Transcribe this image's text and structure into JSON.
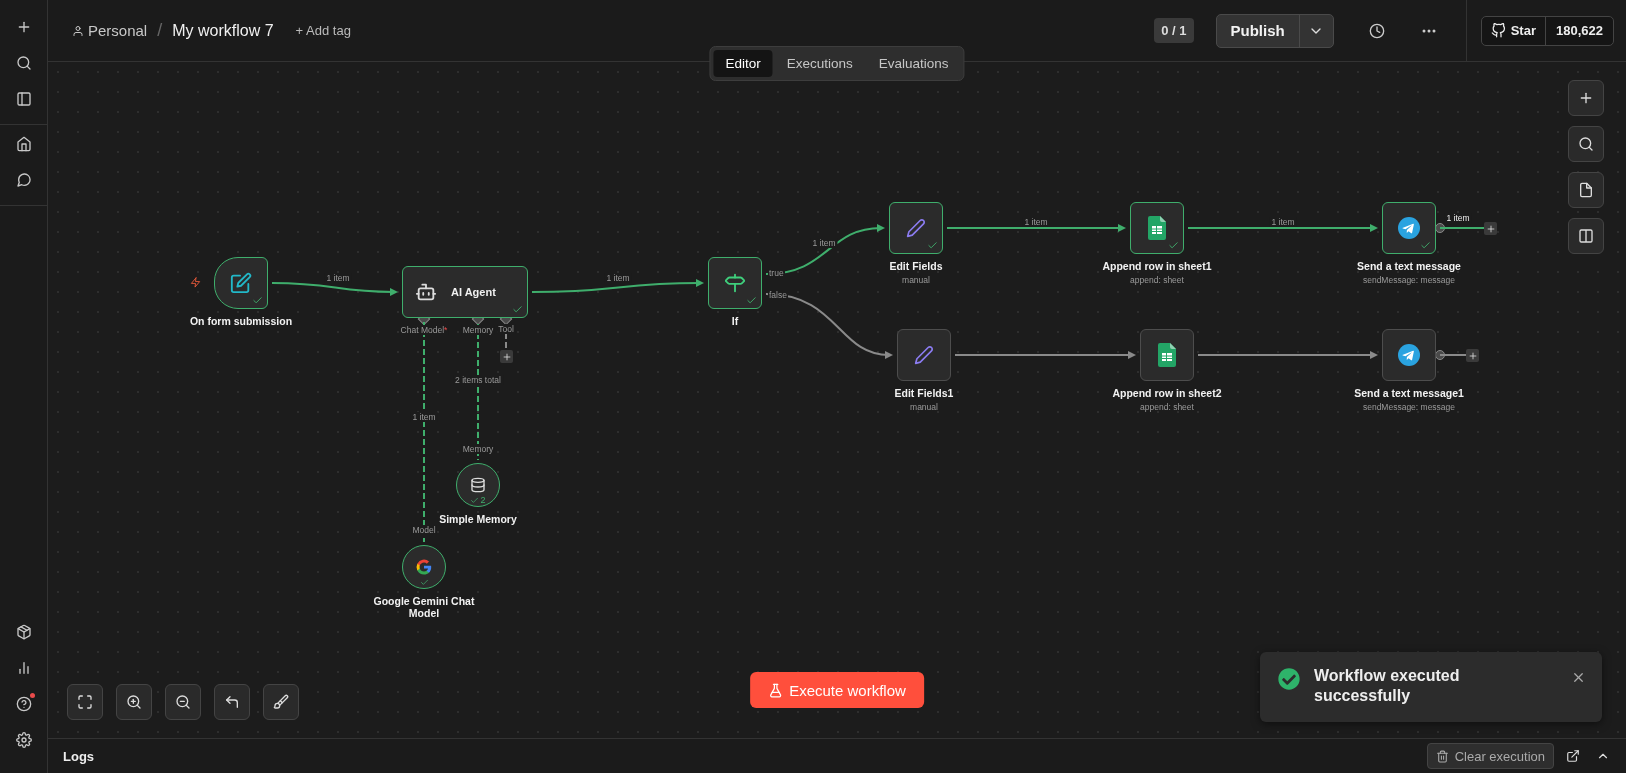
{
  "sidebar": {
    "help_notification": true
  },
  "top_bar": {
    "project": "Personal",
    "separator": "/",
    "workflow_name": "My workflow 7",
    "add_tag": "+ Add tag",
    "version_counter": "0 / 1",
    "publish": "Publish",
    "github": {
      "label": "Star",
      "count": "180,622"
    }
  },
  "tabs": [
    {
      "label": "Editor",
      "selected": true
    },
    {
      "label": "Executions",
      "selected": false
    },
    {
      "label": "Evaluations",
      "selected": false
    }
  ],
  "canvas": {
    "nodes": [
      {
        "name": "On form submission",
        "kind": "form_trigger",
        "executed": true
      },
      {
        "name": "AI Agent",
        "kind": "agent",
        "executed": true
      },
      {
        "name": "If",
        "kind": "if",
        "executed": true
      },
      {
        "name": "Edit Fields",
        "subtitle": "manual",
        "kind": "set",
        "executed": true
      },
      {
        "name": "Append row in sheet1",
        "subtitle": "append: sheet",
        "kind": "sheets",
        "executed": true
      },
      {
        "name": "Send a text message",
        "subtitle": "sendMessage: message",
        "kind": "telegram",
        "executed": true
      },
      {
        "name": "Edit Fields1",
        "subtitle": "manual",
        "kind": "set",
        "executed": false
      },
      {
        "name": "Append row in sheet2",
        "subtitle": "append: sheet",
        "kind": "sheets",
        "executed": false
      },
      {
        "name": "Send a text message1",
        "subtitle": "sendMessage: message",
        "kind": "telegram",
        "executed": false
      },
      {
        "name": "Simple Memory",
        "kind": "memory",
        "executed": true,
        "run_count": "2"
      },
      {
        "name": "Google Gemini Chat Model",
        "kind": "model",
        "executed": true
      }
    ],
    "connections": [
      {
        "label": "1 item",
        "kind": "main",
        "active": true
      },
      {
        "label": "1 item",
        "kind": "main",
        "active": true
      },
      {
        "label": "1 item",
        "kind": "main",
        "active": true
      },
      {
        "label": "1 item",
        "kind": "main",
        "active": true
      },
      {
        "label": "1 item",
        "kind": "main",
        "active": true
      },
      {
        "label": "1 item",
        "kind": "main",
        "active": true
      },
      {
        "kind": "main",
        "active": false
      },
      {
        "kind": "main",
        "active": false
      },
      {
        "kind": "main",
        "active": false
      },
      {
        "kind": "main",
        "active": false
      },
      {
        "label": "1 item",
        "kind": "ai",
        "active": true
      },
      {
        "label": "2 items total",
        "kind": "ai",
        "active": true
      },
      {
        "kind": "ai",
        "active": false
      }
    ],
    "port_labels": [
      {
        "text": "true"
      },
      {
        "text": "false"
      },
      {
        "text": "Chat Model",
        "marker": "*"
      },
      {
        "text": "Memory"
      },
      {
        "text": "Tool"
      },
      {
        "text": "Memory"
      },
      {
        "text": "Model"
      }
    ]
  },
  "execute_button": "Execute workflow",
  "toast": {
    "message": "Workflow executed successfully"
  },
  "logs": {
    "title": "Logs",
    "clear_button": "Clear execution"
  }
}
